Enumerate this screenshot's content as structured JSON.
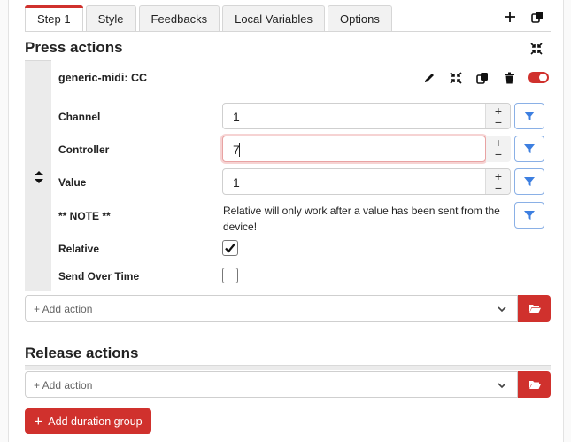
{
  "tabs": [
    {
      "label": "Step 1",
      "active": true
    },
    {
      "label": "Style",
      "active": false
    },
    {
      "label": "Feedbacks",
      "active": false
    },
    {
      "label": "Local Variables",
      "active": false
    },
    {
      "label": "Options",
      "active": false
    }
  ],
  "toolbar_icons": [
    "plus-icon",
    "copy-icon"
  ],
  "press_actions": {
    "title": "Press actions",
    "collapse_icon": "collapse-icon",
    "action": {
      "name": "generic-midi: CC",
      "icons": [
        "pencil-icon",
        "collapse-icon",
        "copy-icon",
        "trash-icon"
      ],
      "enabled": true,
      "fields": {
        "channel": {
          "label": "Channel",
          "value": "1"
        },
        "controller": {
          "label": "Controller",
          "value": "7"
        },
        "value": {
          "label": "Value",
          "value": "1"
        },
        "note": {
          "label": "** NOTE **",
          "text": "Relative will only work after a value has been sent from the device!"
        },
        "relative": {
          "label": "Relative",
          "checked": true
        },
        "send_over_time": {
          "label": "Send Over Time",
          "checked": false
        }
      },
      "stepper": {
        "plus": "+",
        "minus": "−"
      }
    },
    "add_action": "+ Add action"
  },
  "release_actions": {
    "title": "Release actions",
    "add_action": "+ Add action"
  },
  "add_duration_group": "Add duration group",
  "add_duration_plus": "+",
  "colors": {
    "accent": "#d0312d",
    "filter_blue": "#3d7fe0"
  }
}
